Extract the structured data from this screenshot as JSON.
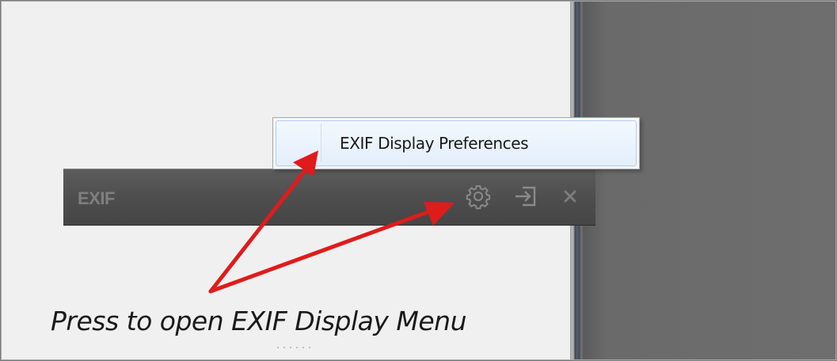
{
  "menu": {
    "item_label": "EXIF Display Preferences"
  },
  "panel": {
    "title": "EXIF",
    "icons": [
      "gear-icon",
      "dock-icon",
      "close-icon"
    ]
  },
  "annotation": {
    "caption": "Press to open EXIF Display Menu",
    "arrow_color": "#e01b1b"
  },
  "colors": {
    "left_panel_bg": "#f0f0f0",
    "right_panel_bg": "#6e6e6e",
    "header_bar_bg": "#4e4e4e",
    "menu_highlight": "#e4effb"
  }
}
